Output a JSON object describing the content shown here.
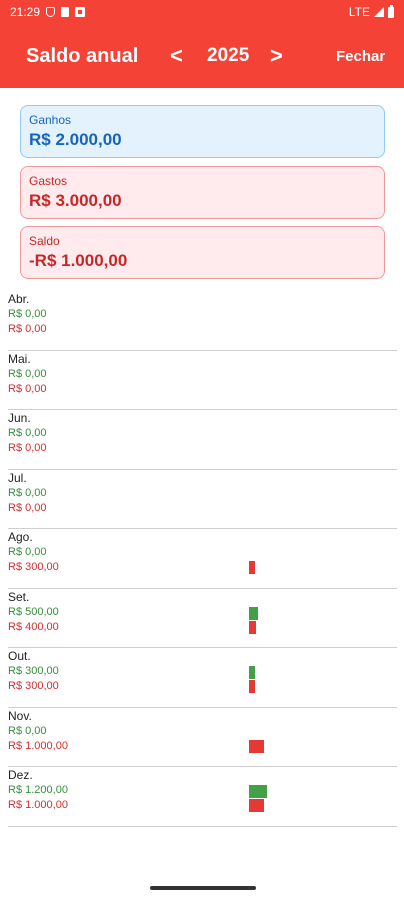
{
  "status_bar": {
    "time": "21:29",
    "network": "LTE",
    "icons": [
      "shield-icon",
      "sim-card-icon",
      "notification-box-icon",
      "signal-icon",
      "battery-icon"
    ]
  },
  "app_bar": {
    "title": "Saldo anual",
    "prev_label": "<",
    "year": "2025",
    "next_label": ">",
    "close_label": "Fechar",
    "color": "#f44336"
  },
  "summary": {
    "income": {
      "label": "Ganhos",
      "value": "R$ 2.000,00"
    },
    "expense": {
      "label": "Gastos",
      "value": "R$ 3.000,00"
    },
    "balance": {
      "label": "Saldo",
      "value": "-R$ 1.000,00"
    }
  },
  "colors": {
    "income": "#43a047",
    "expense": "#e53935"
  },
  "bar_max_value": 1200,
  "months": [
    {
      "name": "Abr.",
      "income": "R$ 0,00",
      "expense": "R$ 0,00",
      "income_value": 0,
      "expense_value": 0
    },
    {
      "name": "Mai.",
      "income": "R$ 0,00",
      "expense": "R$ 0,00",
      "income_value": 0,
      "expense_value": 0
    },
    {
      "name": "Jun.",
      "income": "R$ 0,00",
      "expense": "R$ 0,00",
      "income_value": 0,
      "expense_value": 0
    },
    {
      "name": "Jul.",
      "income": "R$ 0,00",
      "expense": "R$ 0,00",
      "income_value": 0,
      "expense_value": 0
    },
    {
      "name": "Ago.",
      "income": "R$ 0,00",
      "expense": "R$ 300,00",
      "income_value": 0,
      "expense_value": 300
    },
    {
      "name": "Set.",
      "income": "R$ 500,00",
      "expense": "R$ 400,00",
      "income_value": 500,
      "expense_value": 400
    },
    {
      "name": "Out.",
      "income": "R$ 300,00",
      "expense": "R$ 300,00",
      "income_value": 300,
      "expense_value": 300
    },
    {
      "name": "Nov.",
      "income": "R$ 0,00",
      "expense": "R$ 1.000,00",
      "income_value": 0,
      "expense_value": 1000
    },
    {
      "name": "Dez.",
      "income": "R$ 1.200,00",
      "expense": "R$ 1.000,00",
      "income_value": 1200,
      "expense_value": 1000
    }
  ]
}
